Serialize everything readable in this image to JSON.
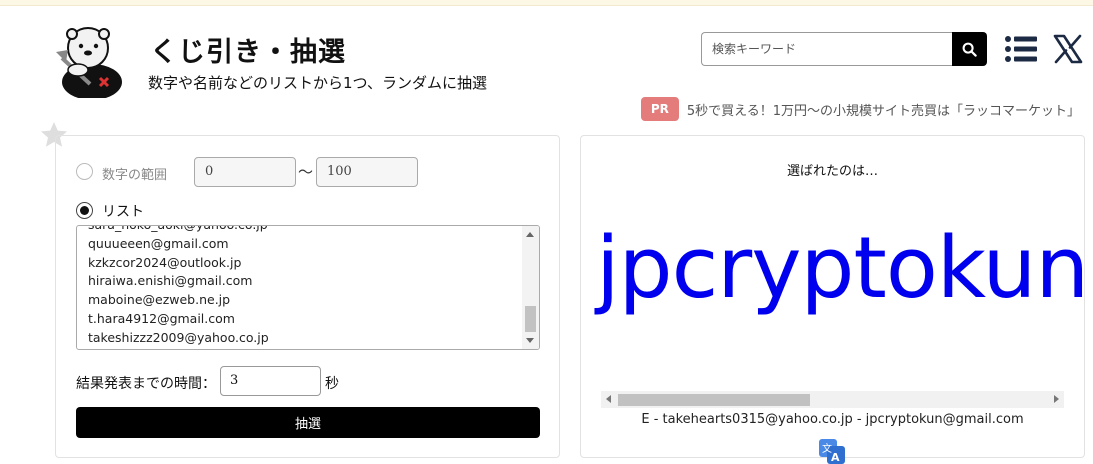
{
  "header": {
    "title": "くじ引き・抽選",
    "subtitle": "数字や名前などのリストから1つ、ランダムに抽選",
    "search_placeholder": "検索キーワード"
  },
  "ad": {
    "badge": "PR",
    "text": "5秒で買える！1万円〜の小規模サイト売買は「ラッコマーケット」"
  },
  "form": {
    "range_label": "数字の範囲",
    "range_from": "0",
    "range_separator": "〜",
    "range_to": "100",
    "list_label": "リスト",
    "list_items": [
      "sara_hoko_aoki@yahoo.co.jp",
      "quuueeen@gmail.com",
      "kzkzcor2024@outlook.jp",
      "hiraiwa.enishi@gmail.com",
      "maboine@ezweb.ne.jp",
      "t.hara4912@gmail.com",
      "takeshizzz2009@yahoo.co.jp"
    ],
    "time_label": "結果発表までの時間：",
    "time_value": "3",
    "time_unit": "秒",
    "draw_button": "抽選"
  },
  "result": {
    "label": "選ばれたのは…",
    "winner": "jpcryptokun@gmail.com",
    "pair": "E - takehearts0315@yahoo.co.jp - jpcryptokun@gmail.com"
  },
  "icons": {
    "search": "search-icon",
    "menu": "menu-list-icon",
    "x": "x-logo-icon",
    "star": "star-icon",
    "translate": "translate-icon"
  },
  "colors": {
    "winner_text": "#0000ee",
    "pr_badge": "#e47c7c",
    "button_bg": "#000000"
  }
}
